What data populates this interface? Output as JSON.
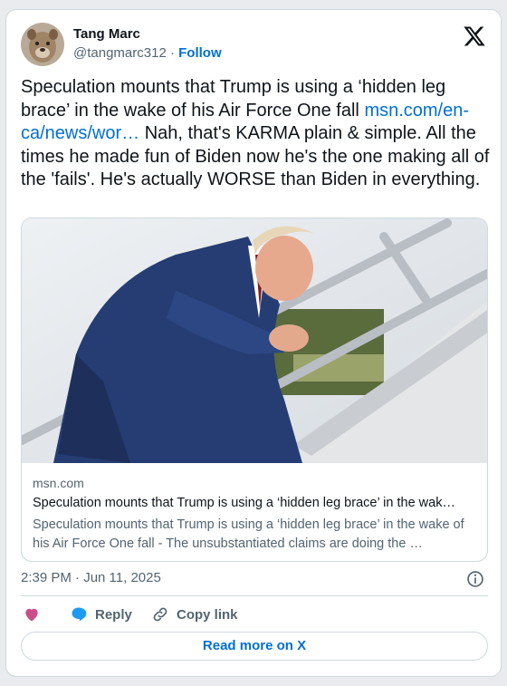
{
  "author": {
    "name": "Tang Marc",
    "handle": "@tangmarc312",
    "separator": "·",
    "follow_label": "Follow"
  },
  "tweet": {
    "text_before_link": "Speculation mounts that Trump is using a ‘hidden leg brace’ in the wake of his Air Force One fall ",
    "link_text": "msn.com/en-ca/news/wor…",
    "text_after_link": " Nah, that's KARMA plain & simple. All the times he made fun of Biden now he's the one making all of the 'fails'. He's actually WORSE than Biden in everything."
  },
  "link_card": {
    "domain": "msn.com",
    "title": "Speculation mounts that Trump is using a ‘hidden leg brace’ in the wak…",
    "description": "Speculation mounts that Trump is using a ‘hidden leg brace’ in the wake of his Air Force One fall - The unsubstantiated claims are doing the …"
  },
  "meta": {
    "timestamp": "2:39 PM · Jun 11, 2025"
  },
  "actions": {
    "like_label": "",
    "reply_label": "Reply",
    "copy_label": "Copy link"
  },
  "footer": {
    "read_more_label": "Read more on X"
  },
  "icons": {
    "logo": "x-logo-icon",
    "info": "info-icon",
    "like": "heart-icon",
    "reply": "reply-bubble-icon",
    "copy": "link-icon"
  },
  "colors": {
    "link_blue": "#006fd6",
    "like_pink": "#c94f8a",
    "reply_blue": "#1d9bf0",
    "text_primary": "#0f1419",
    "text_secondary": "#536471",
    "border": "#cfd9de"
  }
}
